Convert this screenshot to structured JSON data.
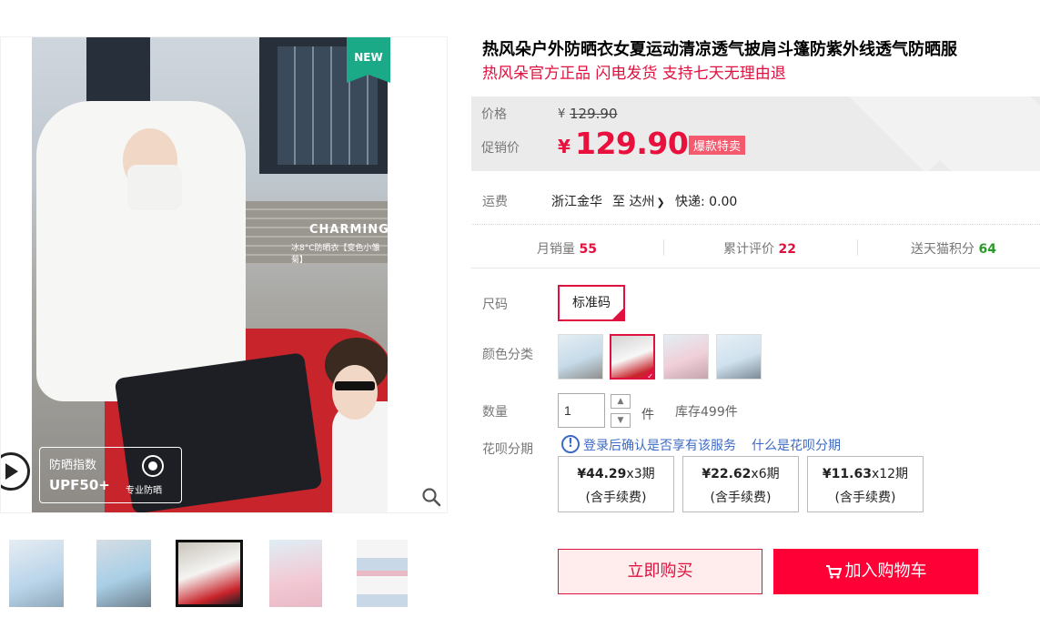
{
  "gallery": {
    "new_badge": "NEW",
    "charming": "CHARMING",
    "charming_sub": "冰8°C防晒衣【变色小雏菊】",
    "uv_title": "防晒指数",
    "uv_value": "UPF50+",
    "uv_pro": "专业防晒",
    "thumbnails": [
      {
        "selected": false,
        "color": "#b9d4ea"
      },
      {
        "selected": false,
        "color": "#a9cfe6"
      },
      {
        "selected": true,
        "color": "#d9d3cc"
      },
      {
        "selected": false,
        "color": "#f2c9d4"
      },
      {
        "selected": false,
        "color": "#e9e9e9"
      }
    ]
  },
  "product": {
    "title": "热风朵户外防晒衣女夏运动清凉透气披肩斗篷防紫外线透气防晒服",
    "subtitle": "热风朵官方正品 闪电发货 支持七天无理由退"
  },
  "price": {
    "label": "价格",
    "currency": "¥",
    "original": "129.90",
    "promo_label": "促销价",
    "promo": "129.90",
    "tag": "爆款特卖"
  },
  "shipping": {
    "label": "运费",
    "from": "浙江金华",
    "to_label": "至 达州",
    "express": "快递: 0.00"
  },
  "stats": {
    "monthly_label": "月销量",
    "monthly_value": "55",
    "reviews_label": "累计评价",
    "reviews_value": "22",
    "points_label": "送天猫积分",
    "points_value": "64"
  },
  "size": {
    "label": "尺码",
    "option": "标准码"
  },
  "color": {
    "label": "颜色分类",
    "options": [
      {
        "selected": false,
        "color": "#c6dbe9"
      },
      {
        "selected": true,
        "color": "#dfe3e8"
      },
      {
        "selected": false,
        "color": "#f0cfd8"
      },
      {
        "selected": false,
        "color": "#cfe1ee"
      }
    ]
  },
  "quantity": {
    "label": "数量",
    "value": "1",
    "unit": "件",
    "stock": "库存499件"
  },
  "huabei": {
    "label": "花呗分期",
    "notice": "登录后确认是否享有该服务",
    "link": "什么是花呗分期",
    "plans": [
      {
        "amount": "¥44.29",
        "period": "x3期",
        "fee": "(含手续费)"
      },
      {
        "amount": "¥22.62",
        "period": "x6期",
        "fee": "(含手续费)"
      },
      {
        "amount": "¥11.63",
        "period": "x12期",
        "fee": "(含手续费)"
      }
    ]
  },
  "actions": {
    "buy_now": "立即购买",
    "add_cart": "加入购物车"
  },
  "colors": {
    "accent": "#e0113e",
    "cart_red": "#ff0036",
    "stat_red": "#e0113e",
    "points_green": "#2a9a2a",
    "link_blue": "#3d6ac5"
  }
}
